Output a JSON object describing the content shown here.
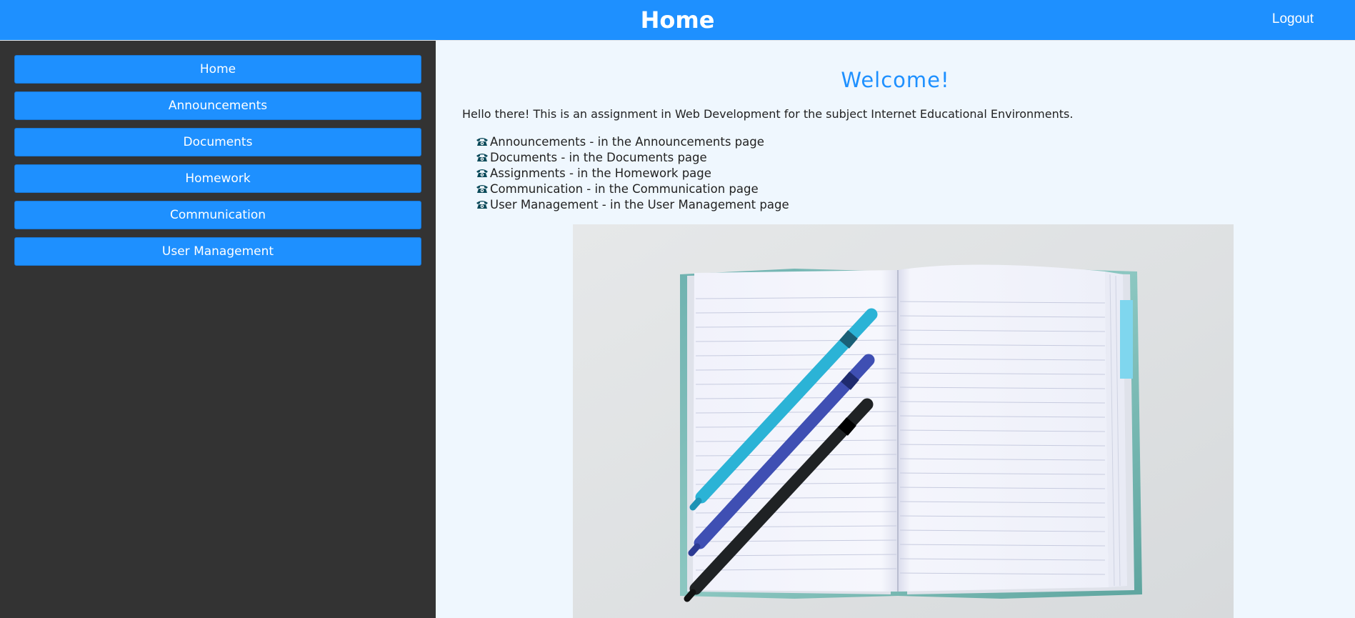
{
  "header": {
    "title": "Home",
    "logout_label": "Logout"
  },
  "sidebar": {
    "items": [
      {
        "label": "Home"
      },
      {
        "label": "Announcements"
      },
      {
        "label": "Documents"
      },
      {
        "label": "Homework"
      },
      {
        "label": "Communication"
      },
      {
        "label": "User Management"
      }
    ]
  },
  "main": {
    "heading": "Welcome!",
    "intro": "Hello there! This is an assignment in Web Development for the subject Internet Educational Environments.",
    "features": [
      {
        "icon": "telephone-icon",
        "text": "Announcements - in the Announcements page"
      },
      {
        "icon": "telephone-icon",
        "text": "Documents - in the Documents page"
      },
      {
        "icon": "telephone-icon",
        "text": "Assignments - in the Homework page"
      },
      {
        "icon": "telephone-icon",
        "text": "Communication - in the Communication page"
      },
      {
        "icon": "telephone-icon",
        "text": "User Management - in the User Management page"
      }
    ],
    "image": {
      "subject": "open notebook with three markers"
    }
  },
  "colors": {
    "brand_blue": "#1e90ff",
    "sidebar_bg": "#333333",
    "content_bg": "#eff7fe"
  }
}
